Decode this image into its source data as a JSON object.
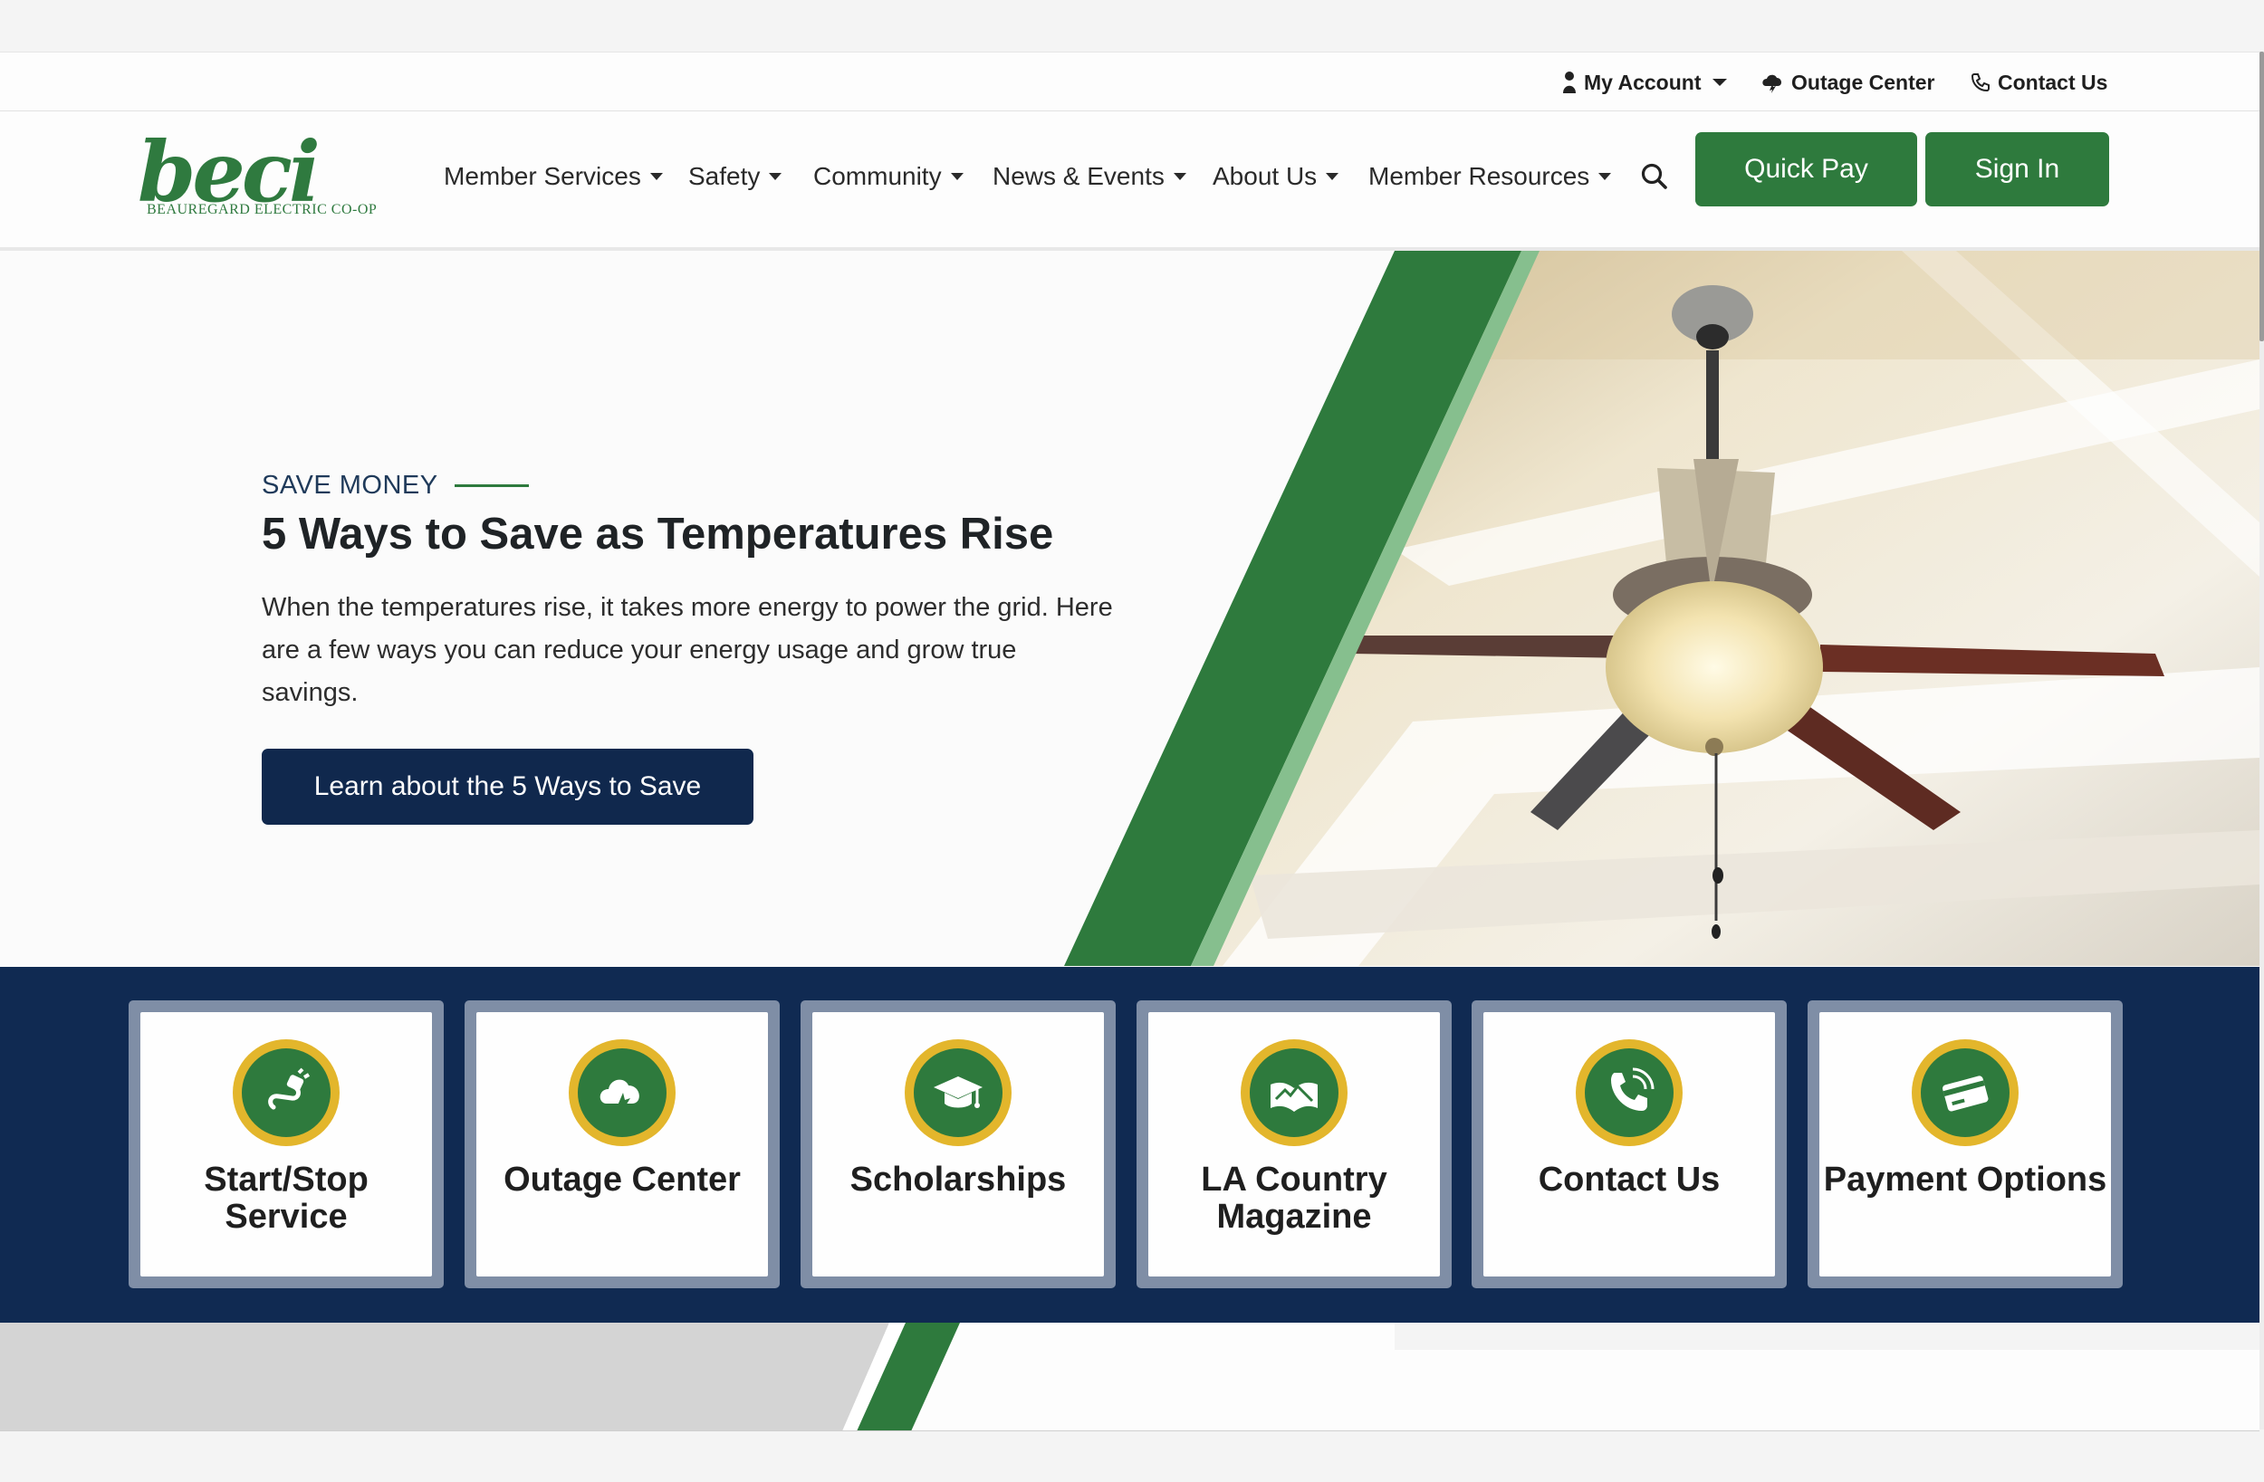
{
  "utility": {
    "my_account": "My Account",
    "outage_center": "Outage Center",
    "contact_us": "Contact Us"
  },
  "logo": {
    "wordmark": "beci",
    "subtitle": "BEAUREGARD ELECTRIC CO-OP"
  },
  "nav": {
    "items": [
      "Member Services",
      "Safety",
      "Community",
      "News & Events",
      "About Us",
      "Member Resources"
    ],
    "quick_pay": "Quick Pay",
    "sign_in": "Sign In"
  },
  "hero": {
    "eyebrow": "SAVE MONEY",
    "title": "5 Ways to Save as Temperatures Rise",
    "body": "When the temperatures rise, it takes more energy to power the grid. Here are a few ways you can reduce your energy usage and grow true savings.",
    "cta": "Learn about the 5 Ways to Save"
  },
  "quick_links": [
    {
      "label": "Start/Stop Service",
      "icon": "plug-icon"
    },
    {
      "label": "Outage Center",
      "icon": "storm-cloud-icon"
    },
    {
      "label": "Scholarships",
      "icon": "graduation-cap-icon"
    },
    {
      "label": "LA Country Magazine",
      "icon": "open-book-icon"
    },
    {
      "label": "Contact Us",
      "icon": "phone-icon"
    },
    {
      "label": "Payment Options",
      "icon": "credit-card-icon"
    }
  ],
  "colors": {
    "brand_green": "#2e7a3d",
    "light_green": "#86bf8e",
    "navy": "#10284d",
    "gold": "#e3b62c"
  }
}
